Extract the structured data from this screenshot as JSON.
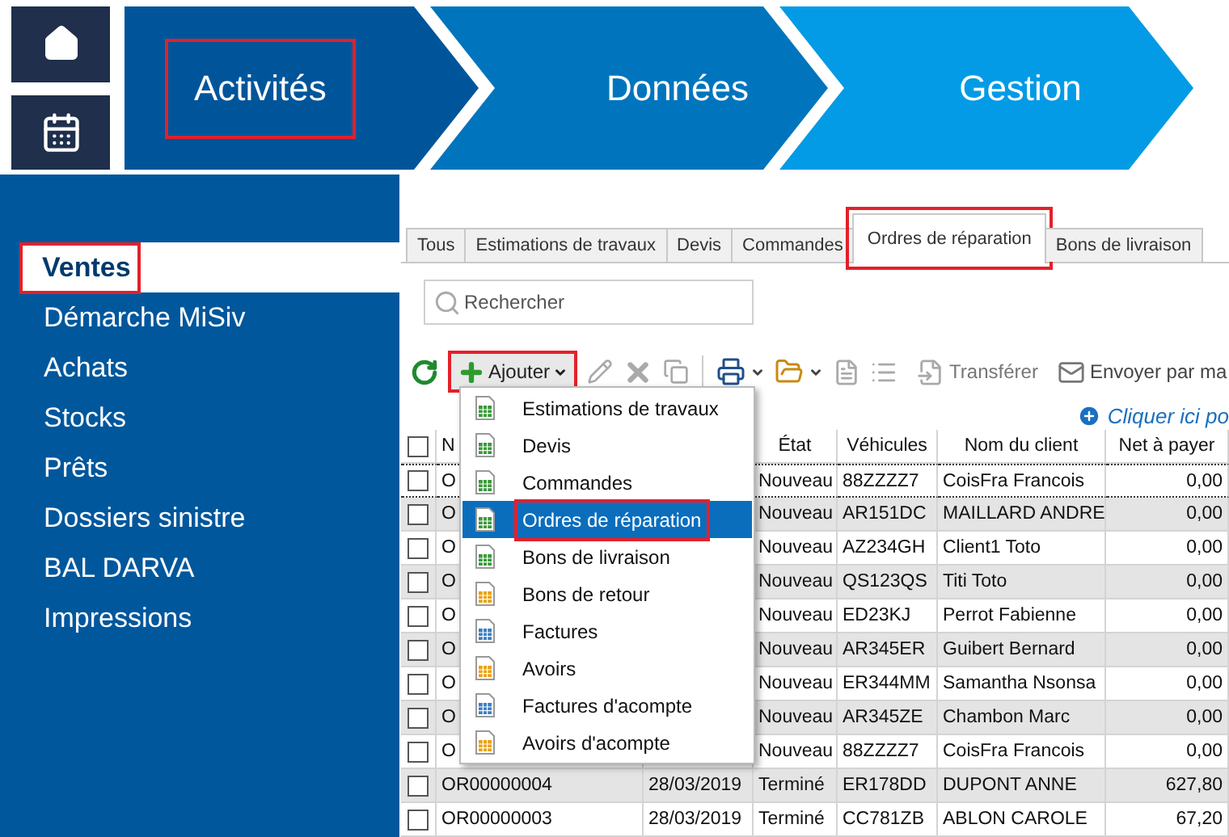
{
  "stages": [
    {
      "label": "Activités",
      "color": "#00559a",
      "highlighted": true
    },
    {
      "label": "Données",
      "color": "#0075bd",
      "highlighted": false
    },
    {
      "label": "Gestion",
      "color": "#039be5",
      "highlighted": false
    }
  ],
  "sidebar": {
    "items": [
      {
        "label": "Ventes",
        "selected": true,
        "highlighted": true
      },
      {
        "label": "Démarche MiSiv",
        "selected": false,
        "highlighted": false
      },
      {
        "label": "Achats",
        "selected": false,
        "highlighted": false
      },
      {
        "label": "Stocks",
        "selected": false,
        "highlighted": false
      },
      {
        "label": "Prêts",
        "selected": false,
        "highlighted": false
      },
      {
        "label": "Dossiers sinistre",
        "selected": false,
        "highlighted": false
      },
      {
        "label": "BAL DARVA",
        "selected": false,
        "highlighted": false
      },
      {
        "label": "Impressions",
        "selected": false,
        "highlighted": false
      }
    ]
  },
  "tabs": [
    {
      "label": "Tous",
      "selected": false,
      "highlighted": false
    },
    {
      "label": "Estimations de travaux",
      "selected": false,
      "highlighted": false
    },
    {
      "label": "Devis",
      "selected": false,
      "highlighted": false
    },
    {
      "label": "Commandes",
      "selected": false,
      "highlighted": false
    },
    {
      "label": "Ordres de réparation",
      "selected": true,
      "highlighted": true
    },
    {
      "label": "Bons de livraison",
      "selected": false,
      "highlighted": false
    }
  ],
  "search": {
    "placeholder": "Rechercher"
  },
  "toolbar": [
    {
      "kind": "refresh",
      "disabled": false
    },
    {
      "kind": "add",
      "label": "Ajouter",
      "disabled": false,
      "highlighted": true
    },
    {
      "kind": "edit",
      "disabled": true
    },
    {
      "kind": "delete",
      "disabled": true
    },
    {
      "kind": "copy",
      "disabled": true
    },
    {
      "kind": "separator"
    },
    {
      "kind": "print",
      "disabled": false
    },
    {
      "kind": "folder",
      "disabled": false
    },
    {
      "kind": "document",
      "disabled": true
    },
    {
      "kind": "list",
      "disabled": true
    },
    {
      "kind": "transfer",
      "label": "Transférer",
      "disabled": true
    },
    {
      "kind": "mail",
      "label": "Envoyer par ma",
      "disabled": false
    }
  ],
  "add_menu": {
    "items": [
      {
        "label": "Estimations de travaux",
        "color": "#3a9a3a",
        "selected": false,
        "highlighted": false
      },
      {
        "label": "Devis",
        "color": "#3a9a3a",
        "selected": false,
        "highlighted": false
      },
      {
        "label": "Commandes",
        "color": "#3a9a3a",
        "selected": false,
        "highlighted": false
      },
      {
        "label": "Ordres de réparation",
        "color": "#3a9a3a",
        "selected": true,
        "highlighted": true
      },
      {
        "label": "Bons de livraison",
        "color": "#3a9a3a",
        "selected": false,
        "highlighted": false
      },
      {
        "label": "Bons de retour",
        "color": "#e8a317",
        "selected": false,
        "highlighted": false
      },
      {
        "label": "Factures",
        "color": "#3b7fc4",
        "selected": false,
        "highlighted": false
      },
      {
        "label": "Avoirs",
        "color": "#e8a317",
        "selected": false,
        "highlighted": false
      },
      {
        "label": "Factures d'acompte",
        "color": "#3b7fc4",
        "selected": false,
        "highlighted": false
      },
      {
        "label": "Avoirs d'acompte",
        "color": "#e8a317",
        "selected": false,
        "highlighted": false
      }
    ]
  },
  "add_row_hint": "Cliquer ici po",
  "table": {
    "all_checked": false,
    "columns": [
      "N",
      "État",
      "Véhicules",
      "Nom du client",
      "Net à payer"
    ],
    "rows": [
      {
        "checked": false,
        "focused": true,
        "number": "O",
        "state": "Nouveau",
        "vehicle": "88ZZZZ7",
        "client": "CoisFra Francois",
        "net": "0,00"
      },
      {
        "checked": false,
        "focused": false,
        "number": "O",
        "state": "Nouveau",
        "vehicle": "AR151DC",
        "client": "MAILLARD ANDRE",
        "net": "0,00"
      },
      {
        "checked": false,
        "focused": false,
        "number": "O",
        "state": "Nouveau",
        "vehicle": "AZ234GH",
        "client": "Client1 Toto",
        "net": "0,00"
      },
      {
        "checked": false,
        "focused": false,
        "number": "O",
        "state": "Nouveau",
        "vehicle": "QS123QS",
        "client": "Titi Toto",
        "net": "0,00"
      },
      {
        "checked": false,
        "focused": false,
        "number": "O",
        "state": "Nouveau",
        "vehicle": "ED23KJ",
        "client": "Perrot Fabienne",
        "net": "0,00"
      },
      {
        "checked": false,
        "focused": false,
        "number": "O",
        "state": "Nouveau",
        "vehicle": "AR345ER",
        "client": "Guibert Bernard",
        "net": "0,00"
      },
      {
        "checked": false,
        "focused": false,
        "number": "O",
        "state": "Nouveau",
        "vehicle": "ER344MM",
        "client": "Samantha Nsonsa",
        "net": "0,00"
      },
      {
        "checked": false,
        "focused": false,
        "number": "O",
        "state": "Nouveau",
        "vehicle": "AR345ZE",
        "client": "Chambon Marc",
        "net": "0,00"
      },
      {
        "checked": false,
        "focused": false,
        "number": "O",
        "state": "Nouveau",
        "vehicle": "88ZZZZ7",
        "client": "CoisFra Francois",
        "net": "0,00"
      },
      {
        "checked": false,
        "focused": false,
        "number": "OR00000004",
        "date": "28/03/2019",
        "state": "Terminé",
        "vehicle": "ER178DD",
        "client": "DUPONT ANNE",
        "net": "627,80"
      },
      {
        "checked": false,
        "focused": false,
        "number": "OR00000003",
        "date": "28/03/2019",
        "state": "Terminé",
        "vehicle": "CC781ZB",
        "client": "ABLON CAROLE",
        "net": "67,20"
      }
    ]
  }
}
